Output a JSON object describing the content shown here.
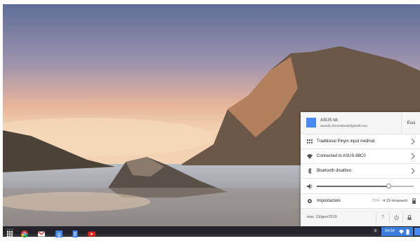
{
  "tray": {
    "user": {
      "name": "ASUS nb",
      "email": "asusnb.chromebook@gmail.com",
      "signout_label": "Esci"
    },
    "ime": {
      "label": "Traditional Pinyin input method",
      "icon": "keyboard-icon"
    },
    "network": {
      "label": "Connected to ASUS-88C0",
      "icon": "wifi-icon"
    },
    "bluetooth": {
      "label": "Bluetooth disattivo",
      "icon": "bluetooth-icon"
    },
    "volume": {
      "level_percent": 74,
      "icon": "speaker-icon"
    },
    "settings": {
      "label": "Impostazioni",
      "battery_percent": "71%",
      "battery_remaining": "4:19 rimanenti",
      "icon": "gear-icon"
    },
    "footer": {
      "date": "mar, 13/gen/2015",
      "help_label": "?",
      "buttons": [
        "help-icon",
        "power-icon",
        "lock-icon"
      ]
    }
  },
  "shelf": {
    "apps": [
      "app-launcher-icon",
      "chrome-icon",
      "gmail-icon",
      "google-search-icon",
      "docs-icon",
      "youtube-icon"
    ],
    "ime_indicator": "8",
    "clock": "04:34",
    "accent_color": "#3b7ee0"
  }
}
